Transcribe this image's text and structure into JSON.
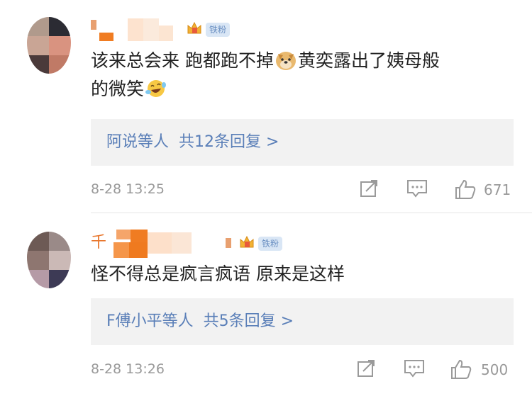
{
  "comments": [
    {
      "user_name_prefix": "",
      "badge_label": "铁粉",
      "text_part1": "该来总会来 跑都跑不掉",
      "text_part2": "黄奕露出了姨母般",
      "text_part3": "的微笑",
      "emojis": [
        "doge-emoji",
        "laugh-cry-emoji"
      ],
      "replies_summary": "阿说等人  共12条回复 >",
      "replies_names": "阿说等人",
      "replies_count": "共12条回复 >",
      "timestamp": "8-28 13:25",
      "like_count": "671"
    },
    {
      "user_name_prefix": "千",
      "badge_label": "铁粉",
      "text_part1": "怪不得总是疯言疯语 原来是这样",
      "replies_names": "F傅小平等人",
      "replies_count": "共5条回复 >",
      "timestamp": "8-28 13:26",
      "like_count": "500"
    }
  ],
  "icons": {
    "share": "share-icon",
    "comment": "comment-icon",
    "like": "like-icon",
    "crown": "crown-badge-icon"
  },
  "colors": {
    "username_orange": "#e8772e",
    "link_blue": "#5a7fb8",
    "reply_bg": "#f2f2f2",
    "meta_gray": "#999999",
    "badge_bg": "#d9e6f5"
  }
}
